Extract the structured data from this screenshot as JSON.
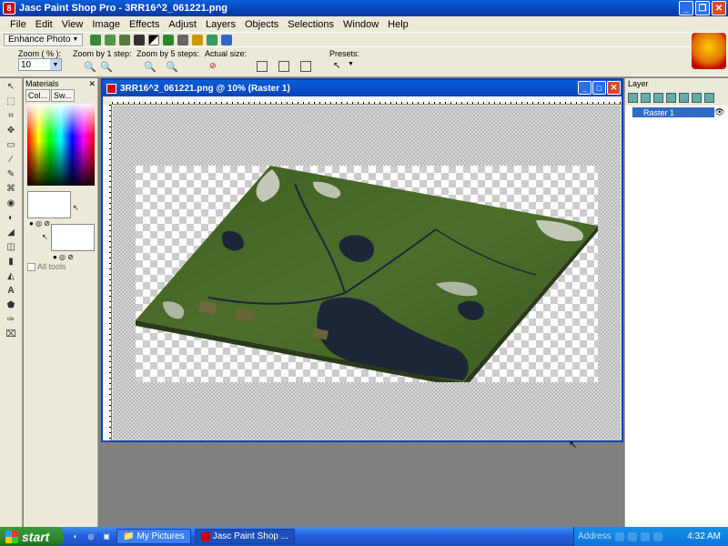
{
  "window": {
    "title": "Jasc Paint Shop Pro - 3RR16^2_061221.png",
    "app_icon": "8"
  },
  "menu": [
    "File",
    "Edit",
    "View",
    "Image",
    "Effects",
    "Adjust",
    "Layers",
    "Objects",
    "Selections",
    "Window",
    "Help"
  ],
  "toolbar": {
    "enhance_label": "Enhance Photo",
    "zoom_label": "Zoom ( % ):",
    "zoom_value": "10",
    "zoom1_label": "Zoom by 1 step:",
    "zoom5_label": "Zoom by 5 steps:",
    "actual_label": "Actual size:",
    "presets_label": "Presets:"
  },
  "materials": {
    "title": "Materials",
    "tab_colors": "Col...",
    "tab_swatches": "Sw...",
    "all_tools": "All tools"
  },
  "layers": {
    "title": "Layer",
    "layer_name": "Raster 1"
  },
  "image_window": {
    "title": "3RR16^2_061221.png @  10% (Raster 1)"
  },
  "taskbar": {
    "start": "start",
    "tasks": [
      "My Pictures",
      "Jasc Paint Shop ..."
    ],
    "address": "Address",
    "clock": "4:32 AM"
  },
  "colors": {
    "xp_blue": "#0842b8",
    "panel": "#ece9d8",
    "terrain_green": "#4a6a2a",
    "water": "#1e2838"
  }
}
